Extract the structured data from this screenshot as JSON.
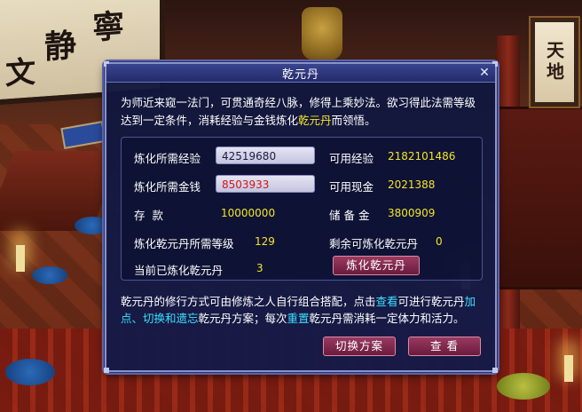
{
  "background": {
    "calligraphy_left": [
      "文",
      "静",
      "寧"
    ],
    "plaque_text": "天地"
  },
  "dialog": {
    "title": "乾元丹",
    "close_glyph": "✕",
    "description_parts": [
      {
        "text": "为师近来窥一法门，可贯通奇经八脉，修得上乘妙法。欲习得此法需等级达到一定条件，消耗经验与金钱炼化",
        "style": "normal"
      },
      {
        "text": "乾元丹",
        "style": "yellow"
      },
      {
        "text": "而领悟。",
        "style": "normal"
      }
    ],
    "rows": {
      "exp_required_label": "炼化所需经验",
      "exp_required_value": "42519680",
      "money_required_label": "炼化所需金钱",
      "money_required_value": "8503933",
      "deposit_label": "存  款",
      "deposit_value": "10000000",
      "level_required_label": "炼化乾元丹所需等级",
      "level_required_value": "129",
      "current_refined_label": "当前已炼化乾元丹",
      "current_refined_value": "3",
      "available_exp_label": "可用经验",
      "available_exp_value": "2182101486",
      "available_cash_label": "可用现金",
      "available_cash_value": "2021388",
      "reserve_label": "储 备 金",
      "reserve_value": "3800909",
      "remaining_label": "剩余可炼化乾元丹",
      "remaining_value": "0"
    },
    "refine_button": "炼化乾元丹",
    "footer_parts": [
      {
        "text": "乾元丹的修行方式可由修炼之人自行组合搭配，点击",
        "style": "normal"
      },
      {
        "text": "查看",
        "style": "cyan"
      },
      {
        "text": "可进行乾元丹",
        "style": "normal"
      },
      {
        "text": "加点、切换和遗忘",
        "style": "cyan"
      },
      {
        "text": "乾元丹方案；每次",
        "style": "normal"
      },
      {
        "text": "重置",
        "style": "cyan"
      },
      {
        "text": "乾元丹需消耗一定体力和活力。",
        "style": "normal"
      }
    ],
    "switch_button": "切换方案",
    "view_button": "查 看"
  },
  "colors": {
    "highlight_yellow": "#f4e428",
    "highlight_cyan": "#3ce0ff",
    "value_red": "#d01818",
    "button_maroon": "#7a2448",
    "dialog_navy": "#141a48"
  }
}
